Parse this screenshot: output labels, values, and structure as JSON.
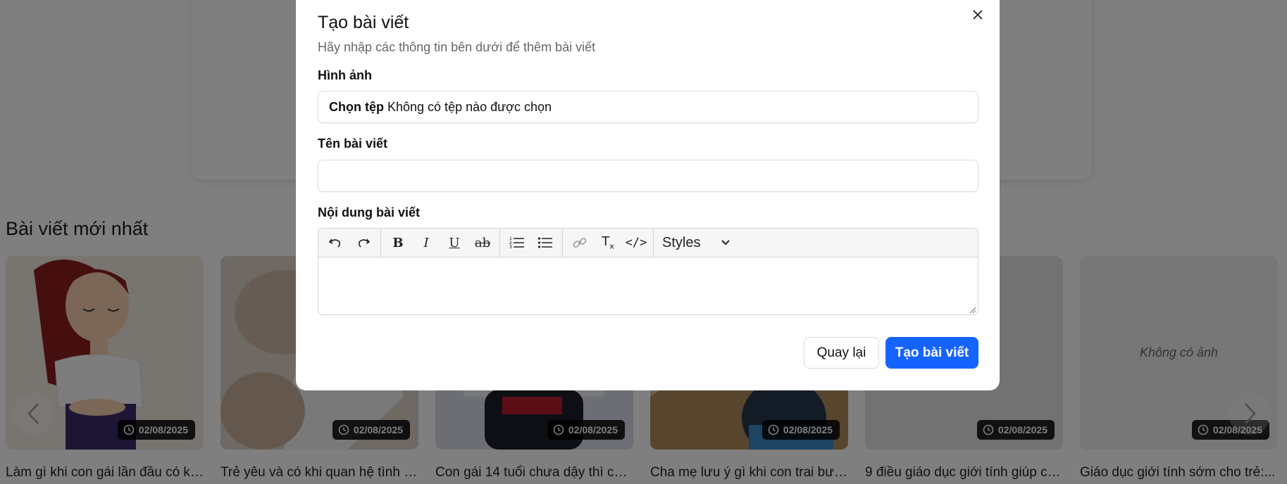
{
  "background": {
    "section_title": "Bài viết mới nhất",
    "cards": [
      {
        "title": "Làm gì khi con gái lần đầu có kin...",
        "date": "02/08/2025"
      },
      {
        "title": "Trẻ yêu và có khi quan hệ tình dụ...",
        "date": "02/08/2025"
      },
      {
        "title": "Con gái 14 tuổi chưa dậy thì có b...",
        "date": "02/08/2025"
      },
      {
        "title": "Cha mẹ lưu ý gì khi con trai bước...",
        "date": "02/08/2025"
      },
      {
        "title": "9 điều giáo dục giới tính giúp co...",
        "date": "02/08/2025"
      },
      {
        "title": "Giáo dục giới tính sớm cho trẻ:...",
        "date": "02/08/2025",
        "placeholder": "Không có ảnh"
      }
    ]
  },
  "modal": {
    "title": "Tạo bài viết",
    "subtitle": "Hãy nhập các thông tin bên dưới để thêm bài viết",
    "image_label": "Hình ảnh",
    "file_button": "Chọn tệp",
    "file_status": "Không có tệp nào được chọn",
    "name_label": "Tên bài viết",
    "name_value": "",
    "content_label": "Nội dung bài viết",
    "toolbar": {
      "styles_label": "Styles",
      "icons": [
        "undo-icon",
        "redo-icon",
        "bold-icon",
        "italic-icon",
        "underline-icon",
        "strikethrough-icon",
        "numbered-list-icon",
        "bulleted-list-icon",
        "link-icon",
        "remove-format-icon",
        "source-code-icon"
      ]
    },
    "back_button": "Quay lại",
    "submit_button": "Tạo bài viết"
  },
  "colors": {
    "primary": "#1664ff",
    "overlay": "rgba(0,0,0,0.5)"
  }
}
